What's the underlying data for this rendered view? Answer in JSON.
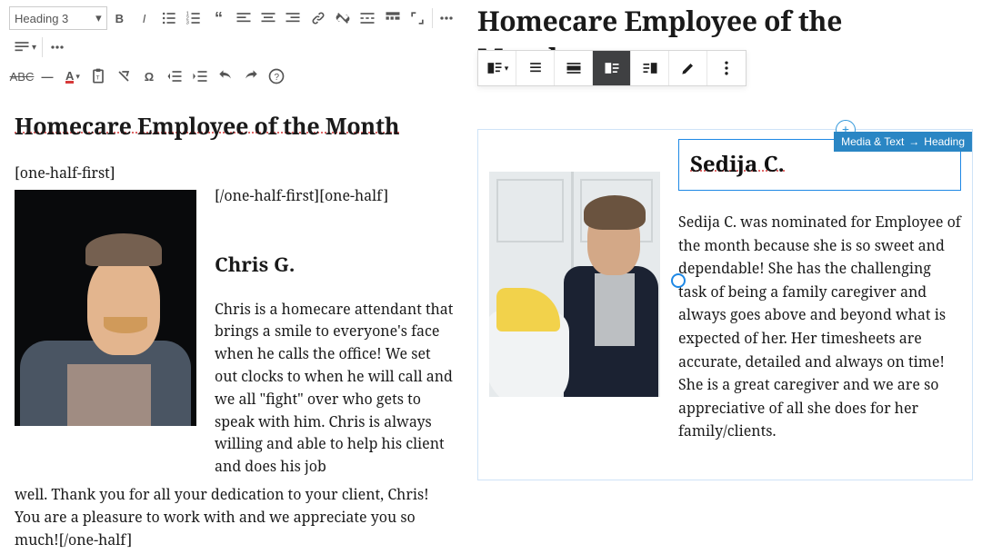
{
  "left": {
    "toolbar": {
      "style_selector": "Heading 3",
      "row1": [
        "bold",
        "italic",
        "bullets",
        "numbers",
        "quote",
        "align-left",
        "align-center",
        "align-right",
        "link",
        "unlink",
        "fullscreen",
        "toolbar-toggle",
        "distraction-free",
        "more"
      ],
      "row2": [
        "paragraph-style",
        "more"
      ],
      "row3": [
        "strike",
        "hr",
        "text-color",
        "paste-text",
        "clear-format",
        "special-char",
        "outdent",
        "indent",
        "undo",
        "redo",
        "help"
      ]
    },
    "heading": "Homecare Employee of the Month",
    "shortcode_open": "[one-half-first]",
    "shortcode_mid": "[/one-half-first][one-half]",
    "subheading": "Chris G.",
    "body_main": "Chris is a homecare attendant that brings a smile to everyone's face when he calls the office! We set out clocks to when he will call and we all \"fight\" over who gets to speak with him. Chris is always willing and able to help his client and does his job",
    "body_tail": "well. Thank you for all your dedication to your client, Chris! You are a pleasure to work with and we appreciate you so much![/one-half]"
  },
  "right": {
    "heading_line1": "Homecare Employee of the",
    "heading_line2": "Month",
    "block_toolbar": [
      "transform",
      "align-left",
      "align-center",
      "media-text-active",
      "media-text-right",
      "edit",
      "more"
    ],
    "breadcrumb_parent": "Media & Text",
    "breadcrumb_child": "Heading",
    "insert_label": "+",
    "block_heading": "Sedija C.",
    "body": "Sedija C. was nominated for Employee of the month because she is so sweet and dependable! She has the challenging task of being a family caregiver and always goes above and beyond what is expected of her. Her timesheets are accurate, detailed and always on time!  She is a great caregiver and we are so appreciative of all she does for her family/clients."
  }
}
